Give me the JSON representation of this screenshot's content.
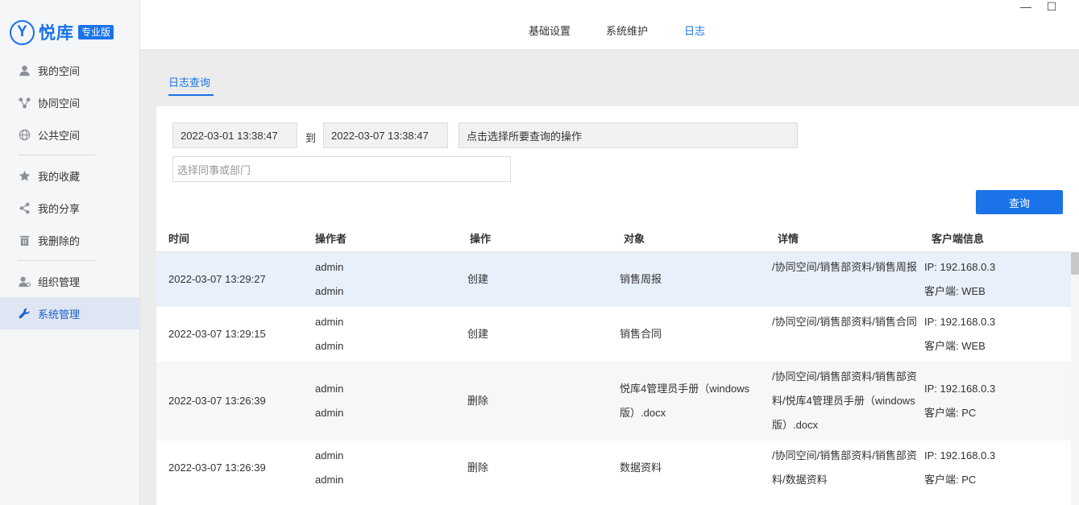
{
  "brand": {
    "mark": "Y",
    "name": "悦库",
    "badge": "专业版"
  },
  "sidebar": {
    "items": [
      {
        "label": "我的空间",
        "icon": "user-icon"
      },
      {
        "label": "协同空间",
        "icon": "collaborate-icon"
      },
      {
        "label": "公共空间",
        "icon": "globe-icon"
      },
      {
        "label": "我的收藏",
        "icon": "star-icon"
      },
      {
        "label": "我的分享",
        "icon": "share-icon"
      },
      {
        "label": "我删除的",
        "icon": "trash-icon"
      },
      {
        "label": "组织管理",
        "icon": "org-icon"
      },
      {
        "label": "系统管理",
        "icon": "wrench-icon",
        "active": true
      }
    ]
  },
  "topnav": {
    "items": [
      "基础设置",
      "系统维护",
      "日志"
    ],
    "active": "日志"
  },
  "window": {
    "minimize": "—",
    "maximize": "☐"
  },
  "subtab": {
    "label": "日志查询"
  },
  "filters": {
    "start": "2022-03-01 13:38:47",
    "to_label": "到",
    "end": "2022-03-07 13:38:47",
    "operation_placeholder": "点击选择所要查询的操作",
    "member_placeholder": "选择同事或部门",
    "query_button": "查询"
  },
  "table": {
    "columns": [
      "时间",
      "操作者",
      "操作",
      "对象",
      "详情",
      "客户端信息"
    ],
    "rows": [
      {
        "time": "2022-03-07 13:29:27",
        "operator1": "admin",
        "operator2": "admin",
        "action": "创建",
        "object": "销售周报",
        "detail": "/协同空间/销售部资料/销售周报",
        "ip": "IP: 192.168.0.3",
        "client": "客户端: WEB"
      },
      {
        "time": "2022-03-07 13:29:15",
        "operator1": "admin",
        "operator2": "admin",
        "action": "创建",
        "object": "销售合同",
        "detail": "/协同空间/销售部资料/销售合同",
        "ip": "IP: 192.168.0.3",
        "client": "客户端: WEB"
      },
      {
        "time": "2022-03-07 13:26:39",
        "operator1": "admin",
        "operator2": "admin",
        "action": "删除",
        "object": "悦库4管理员手册（windows版）.docx",
        "detail": "/协同空间/销售部资料/销售部资料/悦库4管理员手册（windows版）.docx",
        "ip": "IP: 192.168.0.3",
        "client": "客户端: PC"
      },
      {
        "time": "2022-03-07 13:26:39",
        "operator1": "admin",
        "operator2": "admin",
        "action": "删除",
        "object": "数据资料",
        "detail": "/协同空间/销售部资料/销售部资料/数据资料",
        "ip": "IP: 192.168.0.3",
        "client": "客户端: PC"
      }
    ]
  },
  "colors": {
    "accent": "#1a73e8",
    "selected_row": "#e8f0fb"
  }
}
